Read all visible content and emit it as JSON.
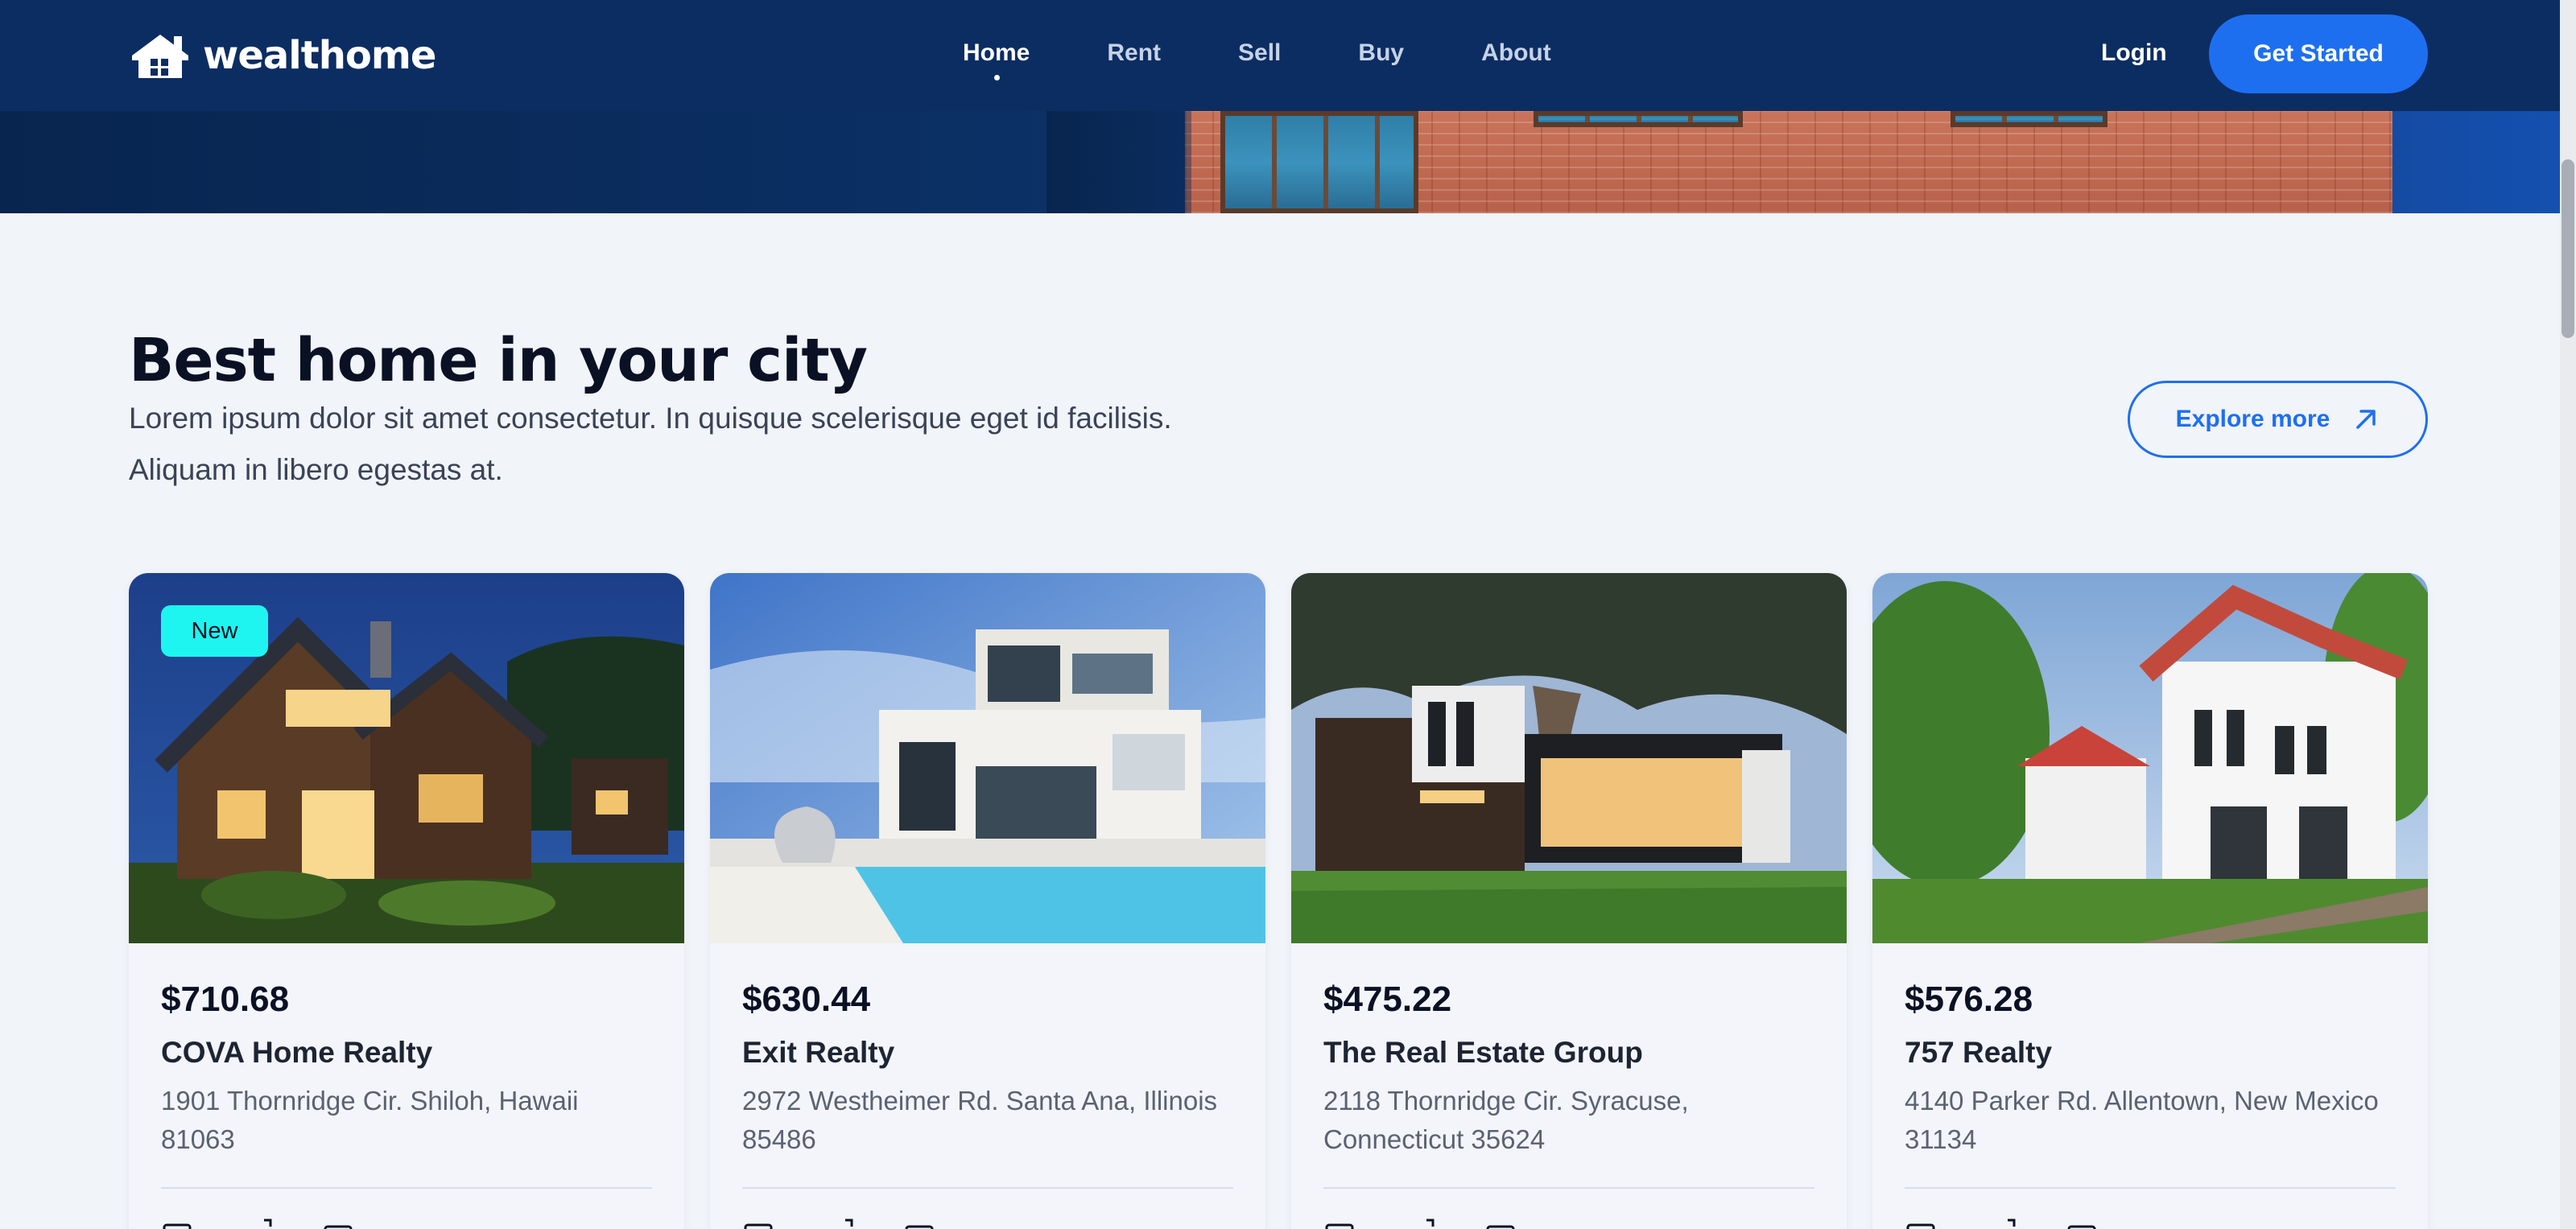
{
  "navbar": {
    "brand": "wealthome",
    "links": [
      {
        "label": "Home",
        "active": true
      },
      {
        "label": "Rent",
        "active": false
      },
      {
        "label": "Sell",
        "active": false
      },
      {
        "label": "Buy",
        "active": false
      },
      {
        "label": "About",
        "active": false
      }
    ],
    "login_label": "Login",
    "cta_label": "Get Started"
  },
  "section": {
    "title": "Best home in your city",
    "subtitle": "Lorem ipsum dolor sit amet consectetur. In quisque scelerisque eget id facilisis. Aliquam in libero egestas at.",
    "explore_label": "Explore more"
  },
  "colors": {
    "navbar_bg": "#0c2d62",
    "accent": "#1e6ff0",
    "badge": "#1ff5f0",
    "page_bg": "#f1f4f9"
  },
  "cards": [
    {
      "badge": "New",
      "price": "$710.68",
      "agency": "COVA Home Realty",
      "address": "1901 Thornridge Cir. Shiloh, Hawaii 81063",
      "image": "night-chalet-house"
    },
    {
      "badge": "",
      "price": "$630.44",
      "agency": "Exit Realty",
      "address": "2972 Westheimer Rd. Santa Ana, Illinois 85486",
      "image": "modern-villa-with-pool"
    },
    {
      "badge": "",
      "price": "$475.22",
      "agency": "The Real Estate Group",
      "address": "2118 Thornridge Cir. Syracuse, Connecticut 35624",
      "image": "modern-house-under-tree"
    },
    {
      "badge": "",
      "price": "$576.28",
      "agency": "757 Realty",
      "address": "4140 Parker Rd. Allentown, New Mexico 31134",
      "image": "white-townhouses-red-roof"
    }
  ],
  "feature_icons": [
    "bed-icon",
    "area-icon",
    "bath-icon"
  ]
}
